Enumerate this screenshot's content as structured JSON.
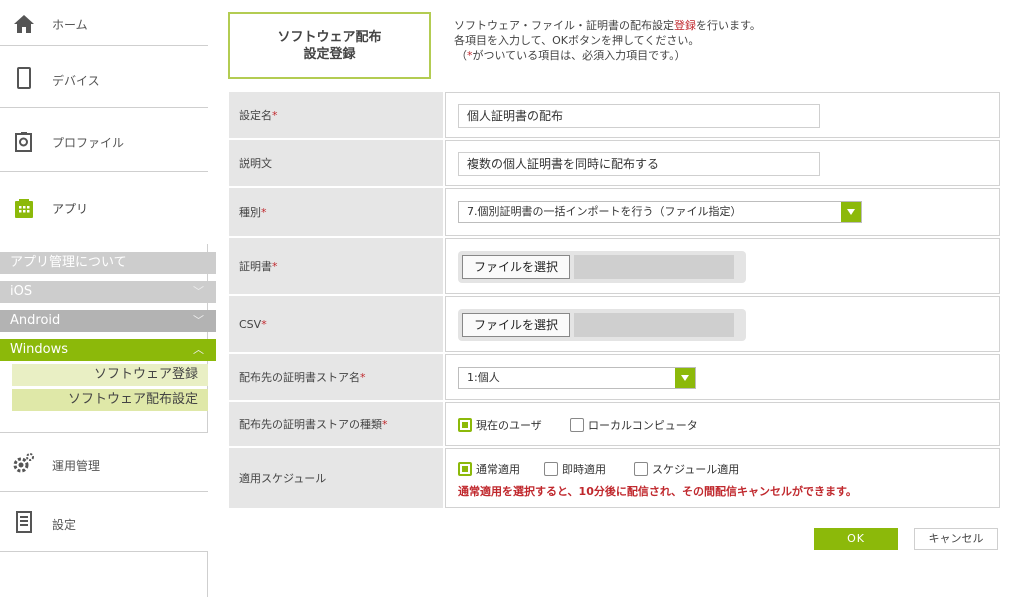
{
  "sidebar": {
    "home": "ホーム",
    "device": "デバイス",
    "profile": "プロファイル",
    "app": "アプリ",
    "app_about": "アプリ管理について",
    "ios": "iOS",
    "android": "Android",
    "windows": "Windows",
    "win_software_register": "ソフトウェア登録",
    "win_software_distribution": "ソフトウェア配布設定",
    "operation": "運用管理",
    "settings": "設定"
  },
  "header": {
    "title_line1": "ソフトウェア配布",
    "title_line2": "設定登録",
    "desc_line1_a": "ソフトウェア・ファイル・証明書の配布設定",
    "desc_line1_b": "登録",
    "desc_line1_c": "を行います。",
    "desc_line2": "各項目を入力して、OKボタンを押してください。",
    "desc_line3_a": "（",
    "desc_line3_b": "*",
    "desc_line3_c": "がついている項目は、必須入力項目です。）"
  },
  "form": {
    "setting_name_label": "設定名",
    "setting_name_value": "個人証明書の配布",
    "description_label": "説明文",
    "description_value": "複数の個人証明書を同時に配布する",
    "type_label": "種別",
    "type_value": "7.個別証明書の一括インポートを行う（ファイル指定）",
    "cert_label": "証明書",
    "csv_label": "CSV",
    "file_button": "ファイルを選択",
    "store_name_label": "配布先の証明書ストア名",
    "store_name_value": "1:個人",
    "store_type_label": "配布先の証明書ストアの種類",
    "store_type_current_user": "現在のユーザ",
    "store_type_local_computer": "ローカルコンピュータ",
    "schedule_label": "適用スケジュール",
    "schedule_normal": "通常適用",
    "schedule_immediate": "即時適用",
    "schedule_scheduled": "スケジュール適用",
    "schedule_note": "通常適用を選択すると、10分後に配信され、その間配信キャンセルができます。",
    "required_mark": "*"
  },
  "buttons": {
    "ok": "OK",
    "cancel": "キャンセル"
  },
  "colors": {
    "accent": "#8cb90a",
    "required": "#c0282d",
    "label_bg": "#e6e6e6"
  }
}
